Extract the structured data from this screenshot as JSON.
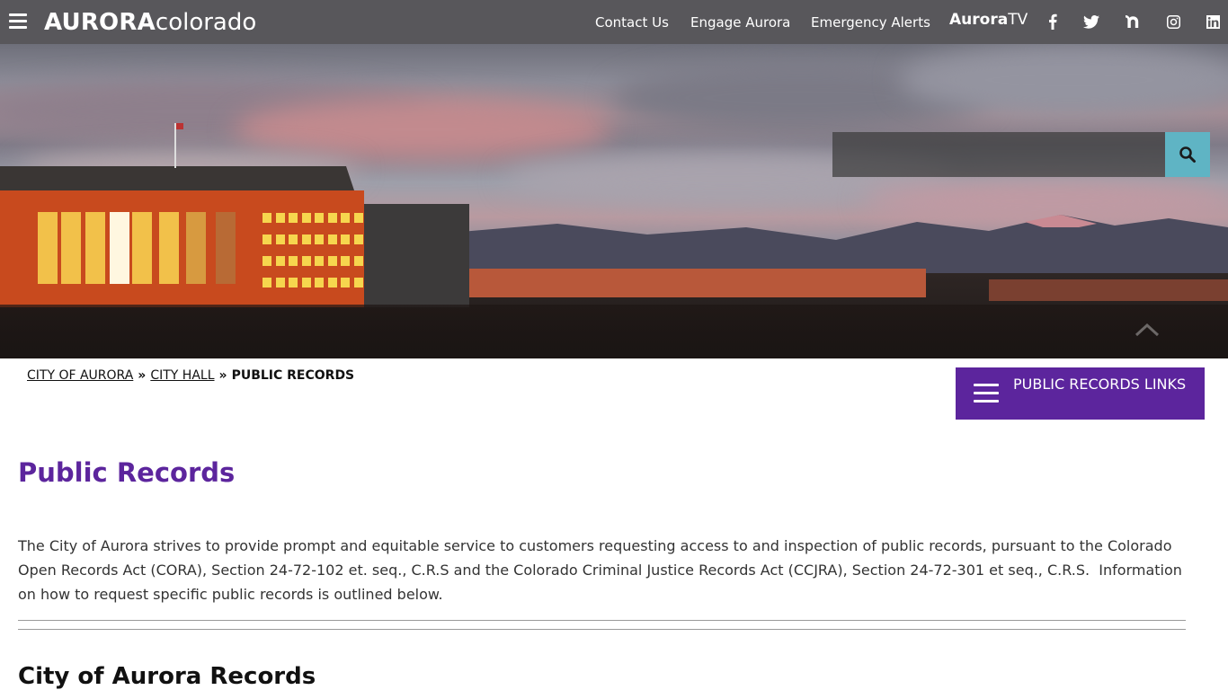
{
  "header": {
    "brand_bold": "AURORA",
    "brand_light": "colorado",
    "menu_icon": "hamburger-icon",
    "nav": [
      {
        "label": "Contact Us"
      },
      {
        "label": "Engage Aurora"
      },
      {
        "label": "Emergency Alerts"
      }
    ],
    "auroratv": {
      "bold": "Aurora",
      "light": "TV"
    },
    "social": [
      {
        "name": "facebook",
        "icon": "facebook-icon"
      },
      {
        "name": "twitter",
        "icon": "twitter-icon"
      },
      {
        "name": "nextdoor",
        "icon": "nextdoor-icon"
      },
      {
        "name": "instagram",
        "icon": "instagram-icon"
      },
      {
        "name": "linkedin",
        "icon": "linkedin-icon"
      }
    ]
  },
  "hero": {
    "search": {
      "placeholder": "",
      "value": "",
      "button_icon": "search-icon"
    },
    "accent_color": "#5fb4c4"
  },
  "breadcrumb": {
    "items": [
      {
        "label": "CITY OF AURORA"
      },
      {
        "label": "CITY HALL"
      }
    ],
    "separator": "»",
    "current": "PUBLIC RECORDS"
  },
  "sidebar_button": {
    "label": "PUBLIC RECORDS LINKS",
    "icon": "hamburger-icon",
    "color": "#5c259d"
  },
  "main": {
    "title": "Public Records",
    "title_color": "#5c259d",
    "intro": "The City of Aurora strives to provide prompt and equitable service to customers requesting access to and inspection of public records, pursuant to the Colorado Open Records Act (CORA), Section 24-72-102 et. seq., C.R.S and the Colorado Criminal Justice Records Act (CCJRA), Section 24-72-301 et seq., C.R.S.  Information on how to request specific public records is outlined below.",
    "section_title": "City of Aurora Records"
  }
}
